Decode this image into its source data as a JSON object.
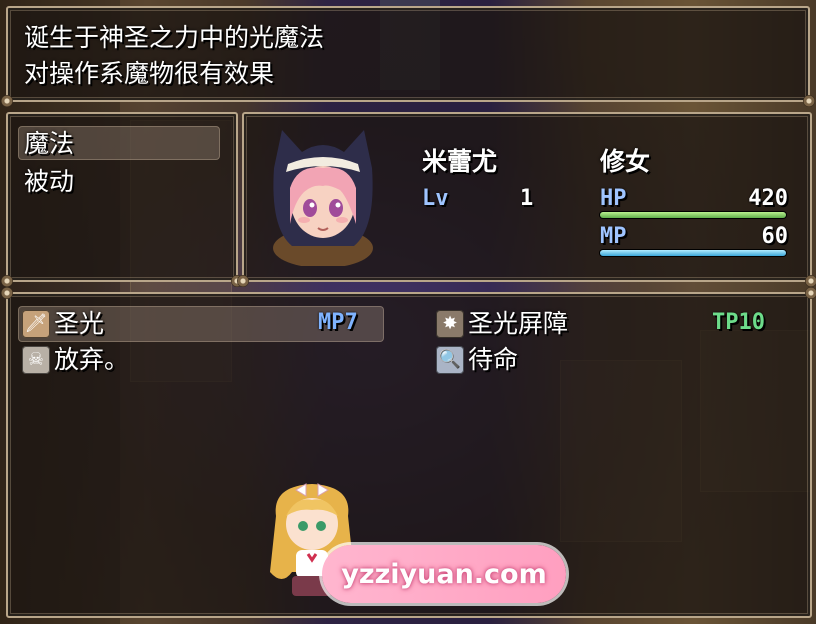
{
  "help": {
    "line1": "诞生于神圣之力中的光魔法",
    "line2": "对操作系魔物很有效果"
  },
  "category": {
    "items": [
      {
        "label": "魔法",
        "selected": true
      },
      {
        "label": "被动",
        "selected": false
      }
    ]
  },
  "actor": {
    "name": "米蕾尤",
    "class": "修女",
    "level_label": "Lv",
    "level": "1",
    "hp_label": "HP",
    "hp": "420",
    "hp_fill": 1.0,
    "mp_label": "MP",
    "mp": "60",
    "mp_fill": 1.0
  },
  "skills": {
    "tp_label": "TP",
    "tp_value": "10",
    "items": [
      {
        "name": "圣光",
        "cost": "MP7",
        "icon": "holy-light-icon",
        "selected": true
      },
      {
        "name": "圣光屏障",
        "cost": "",
        "icon": "holy-barrier-icon",
        "selected": false
      },
      {
        "name": "放弃。",
        "cost": "",
        "icon": "skull-icon",
        "selected": false
      },
      {
        "name": "待命",
        "cost": "",
        "icon": "magnifier-icon",
        "selected": false
      }
    ]
  },
  "watermark": "yzziyuan.com",
  "colors": {
    "hp_bar": "#7ec86a",
    "mp_bar": "#66c3e8",
    "mp_cost": "#7fb3ff",
    "tp": "#6ddc8a",
    "level_label": "#9fc4ff"
  }
}
